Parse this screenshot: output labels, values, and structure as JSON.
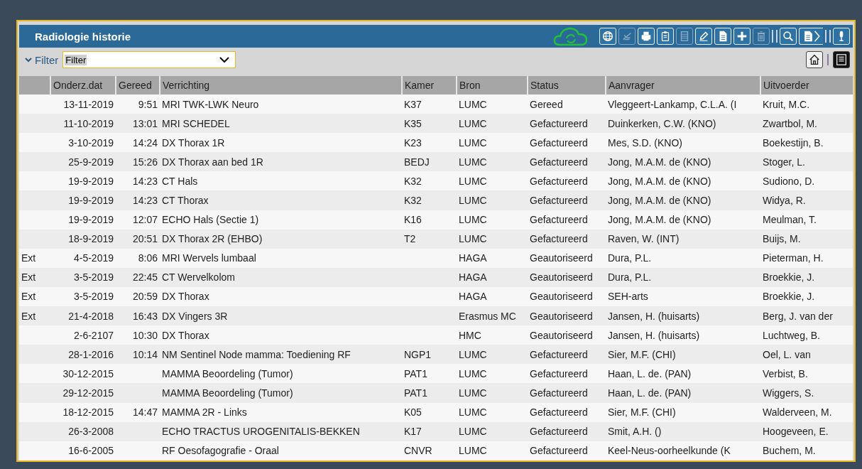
{
  "window": {
    "title": "Radiologie historie"
  },
  "toolbar": [
    {
      "kind": "globe",
      "disabled": false
    },
    {
      "kind": "dish",
      "disabled": true
    },
    {
      "kind": "printer",
      "disabled": false
    },
    {
      "kind": "clipboard",
      "disabled": false
    },
    {
      "kind": "list",
      "disabled": true
    },
    {
      "kind": "pencil",
      "disabled": false
    },
    {
      "kind": "document",
      "disabled": false
    },
    {
      "kind": "plus",
      "disabled": false
    },
    {
      "kind": "trash",
      "disabled": true
    },
    {
      "kind": "separator"
    },
    {
      "kind": "search",
      "disabled": false
    },
    {
      "kind": "export",
      "disabled": false
    },
    {
      "kind": "separator"
    },
    {
      "kind": "microphone",
      "disabled": false
    }
  ],
  "filter": {
    "label": "Filter",
    "value": "Filter"
  },
  "table": {
    "columns": [
      "Onderz.dat",
      "Gereed",
      "Verrichting",
      "Kamer",
      "Bron",
      "Status",
      "Aanvrager",
      "Uitvoerder"
    ],
    "rows": [
      {
        "date": "13-11-2019",
        "time": "9:51",
        "procedure": "MRI TWK-LWK Neuro",
        "room": "K37",
        "source": "LUMC",
        "status": "Gereed",
        "requester": "Vleggeert-Lankamp, C.L.A. (I",
        "performer": "Kruit, M.C."
      },
      {
        "date": "11-10-2019",
        "time": "13:01",
        "procedure": "MRI SCHEDEL",
        "room": "K35",
        "source": "LUMC",
        "status": "Gefactureerd",
        "requester": "Duinkerken, C.W. (KNO)",
        "performer": "Zwartbol, M."
      },
      {
        "date": "3-10-2019",
        "time": "14:24",
        "procedure": "DX Thorax 1R",
        "room": "K23",
        "source": "LUMC",
        "status": "Gefactureerd",
        "requester": "Mes, S.D. (KNO)",
        "performer": "Boekestijn, B."
      },
      {
        "date": "25-9-2019",
        "time": "15:26",
        "procedure": "DX Thorax aan bed 1R",
        "room": "BEDJ",
        "source": "LUMC",
        "status": "Gefactureerd",
        "requester": "Jong, M.A.M. de (KNO)",
        "performer": "Stoger, L."
      },
      {
        "date": "19-9-2019",
        "time": "14:23",
        "procedure": "CT Hals",
        "room": "K32",
        "source": "LUMC",
        "status": "Gefactureerd",
        "requester": "Jong, M.A.M. de (KNO)",
        "performer": "Sudiono, D."
      },
      {
        "date": "19-9-2019",
        "time": "14:23",
        "procedure": "CT Thorax",
        "room": "K32",
        "source": "LUMC",
        "status": "Gefactureerd",
        "requester": "Jong, M.A.M. de (KNO)",
        "performer": "Widya, R."
      },
      {
        "date": "19-9-2019",
        "time": "12:07",
        "procedure": "ECHO Hals (Sectie 1)",
        "room": "K16",
        "source": "LUMC",
        "status": "Gefactureerd",
        "requester": "Jong, M.A.M. de (KNO)",
        "performer": "Meulman, T."
      },
      {
        "date": "18-9-2019",
        "time": "20:51",
        "procedure": "DX Thorax 2R (EHBO)",
        "room": "T2",
        "source": "LUMC",
        "status": "Gefactureerd",
        "requester": "Raven, W. (INT)",
        "performer": "Buijs, M."
      },
      {
        "column_1": "Ext",
        "date": "4-5-2019",
        "time": "8:06",
        "procedure": "MRI Wervels lumbaal",
        "source": "HAGA",
        "status": "Geautoriseerd",
        "requester": "Dura, P.L.",
        "performer": "Pieterman, H."
      },
      {
        "column_1": "Ext",
        "date": "3-5-2019",
        "time": "22:45",
        "procedure": "CT Wervelkolom",
        "source": "HAGA",
        "status": "Geautoriseerd",
        "requester": "Dura, P.L.",
        "performer": "Broekkie, J."
      },
      {
        "column_1": "Ext",
        "date": "3-5-2019",
        "time": "20:59",
        "procedure": "DX Thorax",
        "source": "HAGA",
        "status": "Geautoriseerd",
        "requester": "SEH-arts",
        "performer": "Broekkie, J."
      },
      {
        "column_1": "Ext",
        "date": "21-4-2018",
        "time": "16:43",
        "procedure": "DX Vingers 3R",
        "source": "Erasmus MC",
        "status": "Geautoriseerd",
        "requester": "Jansen, H. (huisarts)",
        "performer": "Berg, J. van der"
      },
      {
        "date": "2-6-2107",
        "time": "10:30",
        "procedure": "DX Thorax",
        "source": "HMC",
        "status": "Geautoriseerd",
        "requester": "Jansen, H. (huisarts)",
        "performer": "Luchtweg, B."
      },
      {
        "date": "28-1-2016",
        "time": "10:14",
        "procedure": "NM Sentinel Node mamma: Toediening RF",
        "room": "NGP1",
        "source": "LUMC",
        "status": "Gefactureerd",
        "requester": "Sier, M.F. (CHI)",
        "performer": "Oel, L. van"
      },
      {
        "date": "30-12-2015",
        "procedure": "MAMMA Beoordeling (Tumor)",
        "room": "PAT1",
        "source": "LUMC",
        "status": "Gefactureerd",
        "requester": "Haan, L. de. (PAN)",
        "performer": "Verbist, B."
      },
      {
        "date": "29-12-2015",
        "procedure": "MAMMA Beoordeling (Tumor)",
        "room": "PAT1",
        "source": "LUMC",
        "status": "Gefactureerd",
        "requester": "Haan, L. de. (PAN)",
        "performer": "Wiggers, S."
      },
      {
        "date": "18-12-2015",
        "time": "14:47",
        "procedure": "MAMMA 2R - Links",
        "room": "K05",
        "source": "LUMC",
        "status": "Gefactureerd",
        "requester": "Sier, M.F. (CHI)",
        "performer": "Walderveen, M."
      },
      {
        "date": "26-3-2008",
        "procedure": "ECHO TRACTUS UROGENITALIS-BEKKEN",
        "room": "K17",
        "source": "LUMC",
        "status": "Gefactureerd",
        "requester": "Smit, A.H. ()",
        "performer": "Hoogeveen, E."
      },
      {
        "date": "16-6-2005",
        "procedure": "RF Oesofagografie - Oraal",
        "room": "CNVR",
        "source": "LUMC",
        "status": "Gefactureerd",
        "requester": "Keel-Neus-oorheelkunde (K",
        "performer": "Buchem, M."
      }
    ]
  }
}
